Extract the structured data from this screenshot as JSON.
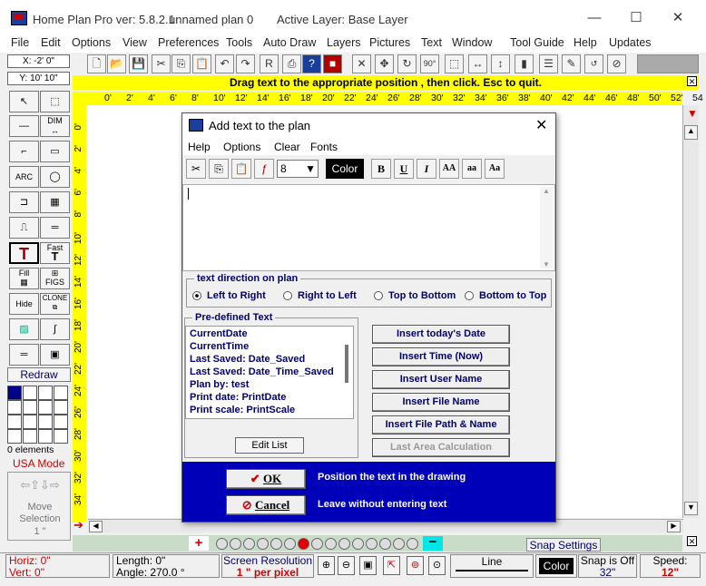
{
  "window": {
    "title": "Home Plan Pro ver: 5.8.2.1",
    "plan_name": "unnamed plan 0",
    "active_layer": "Active Layer: Base Layer",
    "minimize": "—",
    "maximize": "☐",
    "close": "✕"
  },
  "menu": [
    "File",
    "Edit",
    "Options",
    "View",
    "Preferences",
    "Tools",
    "Auto Draw",
    "Layers",
    "Pictures",
    "Text",
    "Window",
    "Tool Guide",
    "Help",
    "Updates"
  ],
  "coords": {
    "x": "X: -2' 0\"",
    "y": "Y: 10' 10\""
  },
  "hint": "Drag text to the appropriate position , then click.  Esc to quit.",
  "ruler_h": [
    "0'",
    "2'",
    "4'",
    "6'",
    "8'",
    "10'",
    "12'",
    "14'",
    "16'",
    "18'",
    "20'",
    "22'",
    "24'",
    "26'",
    "28'",
    "30'",
    "32'",
    "34'",
    "36'",
    "38'",
    "40'",
    "42'",
    "44'",
    "46'",
    "48'",
    "50'",
    "52'",
    "54"
  ],
  "ruler_v": [
    "0'",
    "2'",
    "4'",
    "6'",
    "8'",
    "10'",
    "12'",
    "14'",
    "16'",
    "18'",
    "20'",
    "22'",
    "24'",
    "26'",
    "28'",
    "30'",
    "32'",
    "34'"
  ],
  "palette": {
    "dim": "DIM",
    "fast": "Fast",
    "fill": "Fill",
    "figs": "FIGS",
    "hide": "Hide",
    "clone": "CLONE",
    "arc": "ARC",
    "redraw": "Redraw",
    "elements": "0 elements",
    "units": "USA Mode",
    "move_selection": "Move Selection",
    "move_step": "1 \""
  },
  "dialog": {
    "title": "Add text to the plan",
    "menu": [
      "Help",
      "Options",
      "Clear",
      "Fonts"
    ],
    "font_size": "8",
    "color_label": "Color",
    "direction": {
      "legend": "text direction on plan",
      "options": [
        "Left to Right",
        "Right to Left",
        "Top to Bottom",
        "Bottom to Top"
      ],
      "selected": "Left to Right"
    },
    "predefined": {
      "legend": "Pre-defined Text",
      "items": [
        "CurrentDate",
        "CurrentTime",
        "Last Saved:  Date_Saved",
        "Last Saved:  Date_Time_Saved",
        "Plan by: test",
        "Print date:  PrintDate",
        "Print scale:  PrintScale"
      ],
      "edit_list": "Edit List"
    },
    "insert_buttons": [
      "Insert today's Date",
      "Insert Time (Now)",
      "Insert User Name",
      "Insert File Name",
      "Insert File Path & Name",
      "Last Area Calculation"
    ],
    "ok": "OK",
    "ok_hint": "Position the text in the drawing",
    "cancel": "Cancel",
    "cancel_hint": "Leave without entering text"
  },
  "snap_settings": "Snap Settings",
  "status": {
    "horiz": "Horiz: 0\"",
    "vert": "Vert:  0\"",
    "length": "Length:  0\"",
    "angle": "Angle:  270.0 °",
    "res_label": "Screen Resolution",
    "res_value": "1 \" per pixel",
    "line": "Line",
    "color": "Color",
    "snap": "Snap is Off",
    "snap_value": "32\"",
    "speed": "Speed:",
    "speed_value": "12\""
  },
  "colors": {
    "yellow": "#ffff00",
    "dialog_blue": "#0000b8",
    "red_text": "#d00000",
    "dark_blue_text": "#00006e"
  }
}
